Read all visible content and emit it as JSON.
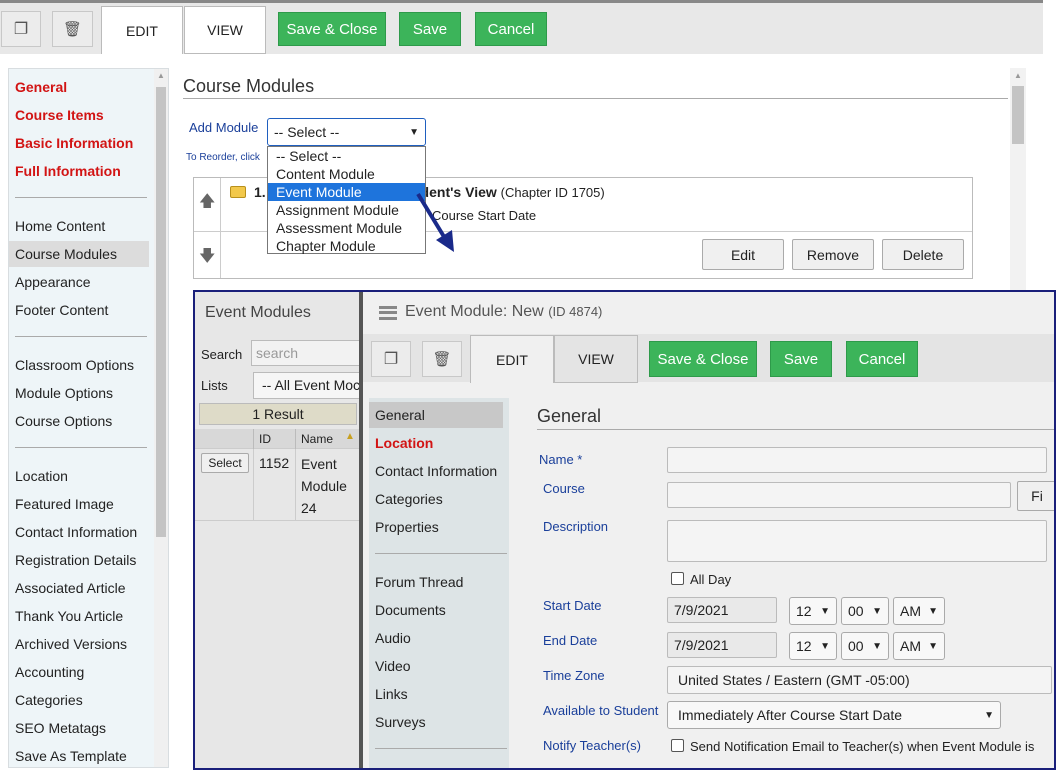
{
  "toolbar": {
    "tab_edit": "EDIT",
    "tab_view": "VIEW",
    "save_close": "Save & Close",
    "save": "Save",
    "cancel": "Cancel"
  },
  "sidebar": {
    "red_items": [
      "General",
      "Course Items",
      "Basic Information",
      "Full Information"
    ],
    "group1": [
      "Home Content",
      "Course Modules",
      "Appearance",
      "Footer Content"
    ],
    "group2": [
      "Classroom Options",
      "Module Options",
      "Course Options"
    ],
    "group3": [
      "Location",
      "Featured Image",
      "Contact Information",
      "Registration Details",
      "Associated Article",
      "Thank You Article",
      "Archived Versions",
      "Accounting",
      "Categories",
      "SEO Metatags",
      "Save As Template"
    ]
  },
  "main": {
    "title": "Course Modules",
    "add_module_label": "Add Module",
    "select_value": "-- Select --",
    "reorder_hint": "To Reorder, click",
    "dropdown_options": [
      "-- Select --",
      "Content Module",
      "Event Module",
      "Assignment Module",
      "Assessment Module",
      "Chapter Module"
    ],
    "module_row": {
      "number": "1.",
      "title_suffix": "udent's View",
      "chapter_id": "(Chapter ID 1705)",
      "subtitle": "Course Start Date"
    },
    "row_buttons": [
      "Edit",
      "Remove",
      "Delete"
    ]
  },
  "overlay": {
    "list_panel": {
      "title": "Event Modules",
      "search_label": "Search",
      "search_placeholder": "search",
      "lists_label": "Lists",
      "lists_value": "-- All Event Moc",
      "result_count": "1 Result",
      "col_id": "ID",
      "col_name": "Name",
      "row": {
        "button": "Select",
        "id": "1152",
        "name_lines": [
          "Event",
          "Module",
          "24"
        ]
      }
    },
    "header": {
      "title": "Event Module: New",
      "id_text": "(ID 4874)"
    },
    "tabs": {
      "edit": "EDIT",
      "view": "VIEW"
    },
    "buttons": {
      "save_close": "Save & Close",
      "save": "Save",
      "cancel": "Cancel"
    },
    "nav": {
      "items1": [
        "General",
        "Location",
        "Contact Information",
        "Categories",
        "Properties"
      ],
      "items2": [
        "Forum Thread",
        "Documents",
        "Audio",
        "Video",
        "Links",
        "Surveys"
      ]
    },
    "form": {
      "section_title": "General",
      "name_label": "Name *",
      "course_label": "Course",
      "course_button": "Fi",
      "description_label": "Description",
      "all_day_label": "All Day",
      "start_label": "Start Date",
      "start_date": "7/9/2021",
      "end_label": "End Date",
      "end_date": "7/9/2021",
      "hour": "12",
      "minute": "00",
      "ampm": "AM",
      "timezone_label": "Time Zone",
      "timezone_value": "United States / Eastern (GMT -05:00)",
      "available_label": "Available to Student",
      "available_value": "Immediately After Course Start Date",
      "notify_label": "Notify Teacher(s)",
      "notify_text": "Send Notification Email to Teacher(s) when Event Module is"
    }
  }
}
